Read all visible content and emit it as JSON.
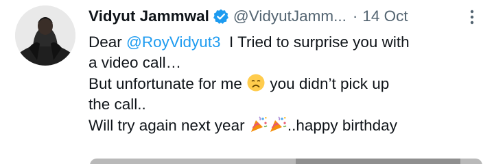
{
  "tweet": {
    "author": {
      "display_name": "Vidyut Jammwal",
      "handle": "@VidyutJamm...",
      "verified": true,
      "avatar_icon": "avatar-photo"
    },
    "separator": "·",
    "date": "14 Oct",
    "more_icon": "more-dots-icon",
    "body": {
      "line1_prefix": "Dear ",
      "mention": "@RoyVidyut3",
      "line1_suffix": "  I Tried to surprise you with",
      "line2": "a video call…",
      "line3_prefix": "But unfortunate for me ",
      "emoji_sad": "disappointed-face",
      "line3_suffix": " you didn’t pick up",
      "line4": "the call..",
      "line5_prefix": "Will try again next year ",
      "emoji_party": "party-popper",
      "line5_suffix": "..happy birthday"
    },
    "colors": {
      "text": "#0f1419",
      "secondary": "#536471",
      "link": "#1d9bf0",
      "verified": "#1d9bf0"
    }
  }
}
